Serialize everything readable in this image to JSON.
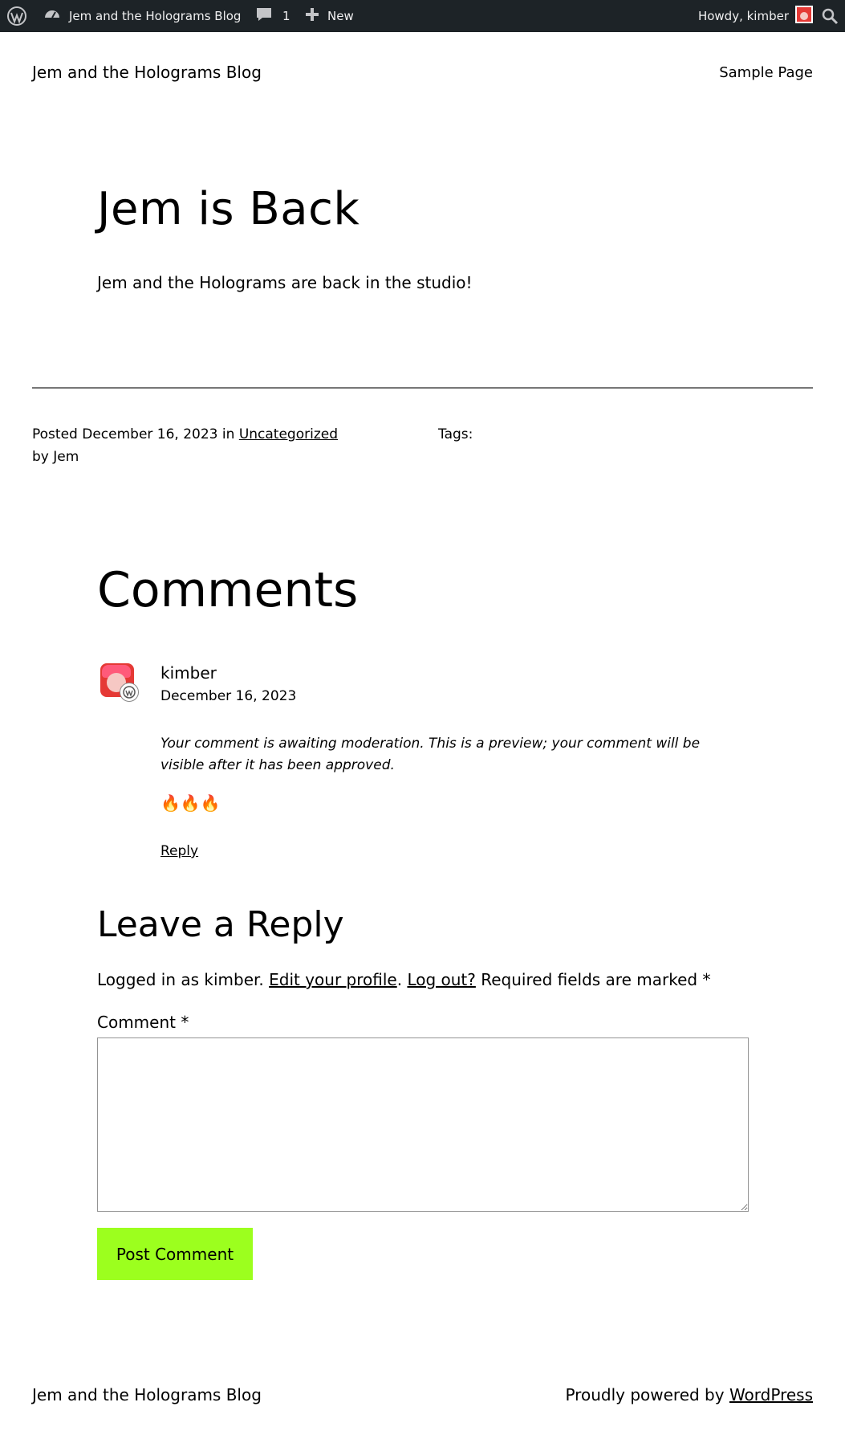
{
  "adminbar": {
    "site_name": "Jem and the Holograms Blog",
    "comments_count": "1",
    "new_label": "New",
    "howdy": "Howdy, kimber"
  },
  "header": {
    "site_title": "Jem and the Holograms Blog",
    "nav_sample": "Sample Page"
  },
  "post": {
    "title": "Jem is Back",
    "body": "Jem and the Holograms are back in the studio!",
    "meta": {
      "posted_prefix": "Posted",
      "date": "December 16, 2023",
      "in_word": "in",
      "category": "Uncategorized",
      "by_line": "by Jem",
      "tags_label": "Tags:"
    }
  },
  "comments": {
    "title": "Comments",
    "items": [
      {
        "author": "kimber",
        "date": "December 16, 2023",
        "moderation": "Your comment is awaiting moderation. This is a preview; your comment will be visible after it has been approved.",
        "text": "🔥🔥🔥",
        "reply_label": "Reply"
      }
    ]
  },
  "reply_form": {
    "title": "Leave a Reply",
    "logged_in_text": "Logged in as kimber.",
    "edit_profile": "Edit your profile",
    "period": ".",
    "log_out": "Log out?",
    "required_text": "Required fields are marked *",
    "comment_label": "Comment *",
    "comment_value": "",
    "submit_label": "Post Comment"
  },
  "footer": {
    "site_title": "Jem and the Holograms Blog",
    "powered_prefix": "Proudly powered by",
    "powered_link": "WordPress"
  },
  "colors": {
    "adminbar_bg": "#1d2327",
    "button_bg": "#9cff1e",
    "divider": "#777777"
  }
}
